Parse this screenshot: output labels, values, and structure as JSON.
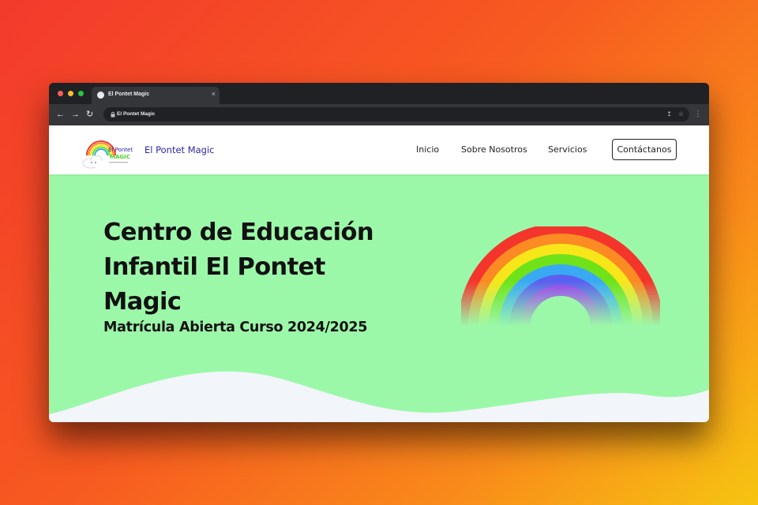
{
  "browser": {
    "tab_title": "El Pontet Magic",
    "tab_close": "×",
    "url": "El Pontet Magic",
    "icons": {
      "back": "arrow-left-icon",
      "forward": "arrow-right-icon",
      "reload": "reload-icon",
      "lock": "lock-icon",
      "share": "share-icon",
      "bookmark": "star-icon",
      "menu": "kebab-menu-icon"
    }
  },
  "site": {
    "logo_text": {
      "line1": "El Pontet",
      "line2": "MAGIC"
    },
    "brand": "El Pontet Magic",
    "nav": {
      "inicio": "Inicio",
      "sobre": "Sobre Nosotros",
      "servicios": "Servicios",
      "contact": "Contáctanos"
    }
  },
  "hero": {
    "title": "Centro de Educación Infantil El Pontet Magic",
    "subtitle": "Matrícula Abierta Curso 2024/2025"
  },
  "colors": {
    "hero_background": "#9cf8a9",
    "brand_text": "#2b27a8",
    "wave": "#f2f5fa",
    "rainbow": [
      "#f4352c",
      "#fb8b22",
      "#f6e61a",
      "#6fe21a",
      "#3aa9f4",
      "#5b5ff0",
      "#9a3ff2"
    ]
  }
}
